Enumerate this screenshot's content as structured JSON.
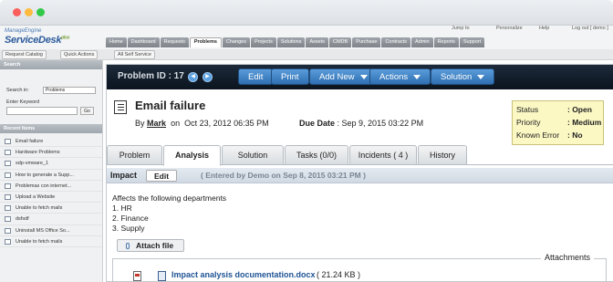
{
  "app": {
    "logo_top": "ManageEngine",
    "logo_name": "ServiceDesk",
    "logo_plus": "plus",
    "toplinks": {
      "jump_to": "Jump to",
      "personalize": "Personalize",
      "help": "Help",
      "logout": "Log out [ demo ]"
    }
  },
  "nav": [
    "Home",
    "Dashboard",
    "Requests",
    "Problems",
    "Changes",
    "Projects",
    "Solutions",
    "Assets",
    "CMDB",
    "Purchase",
    "Contracts",
    "Admin",
    "Reports",
    "Support"
  ],
  "nav_active": "Problems",
  "subbar": {
    "request_catalog": "Request Catalog",
    "quick_actions": "Quick Actions",
    "self_service": "All Self Service"
  },
  "sidebar": {
    "search_title": "Search",
    "search_in_label": "Search in:",
    "search_in_value": "Problems",
    "keyword_label": "Enter Keyword",
    "go": "Go",
    "recent_title": "Recent Items",
    "recent": [
      "Email failure",
      "Hardware Problems",
      "sdp-vmware_1",
      "How to generate a Supp...",
      "Problemas con internet...",
      "Upload a Website",
      "Unable to fetch mails",
      "dsfsdf",
      "Uninstall MS Office So...",
      "Unable to fetch mails"
    ]
  },
  "problem": {
    "id_label": "Problem ID : 17",
    "title": "Email failure",
    "by": "By",
    "author": "Mark",
    "on": "on",
    "created": "Oct 23, 2012 06:35 PM",
    "due_label": "Due Date",
    "due_value": ": Sep 9, 2015 03:22 PM"
  },
  "toolbar": {
    "edit": "Edit",
    "print": "Print",
    "add_new": "Add New",
    "actions": "Actions",
    "solution": "Solution"
  },
  "status": [
    {
      "label": "Status",
      "value": ": Open"
    },
    {
      "label": "Priority",
      "value": ": Medium"
    },
    {
      "label": "Known Error",
      "value": ": No"
    }
  ],
  "tabs": [
    "Problem",
    "Analysis",
    "Solution",
    "Tasks (0/0)",
    "Incidents ( 4 )",
    "History"
  ],
  "active_tab": "Analysis",
  "impact": {
    "label": "Impact",
    "edit": "Edit",
    "entered": "( Entered by Demo on Sep 8, 2015 03:21 PM )",
    "lines": [
      "Affects the following departments",
      "1. HR",
      "2. Finance",
      "3. Supply"
    ]
  },
  "attachments": {
    "button": "Attach file",
    "legend": "Attachments",
    "files": [
      {
        "name": "Impact analysis documentation.docx",
        "size": "( 21.24 KB )"
      }
    ]
  }
}
